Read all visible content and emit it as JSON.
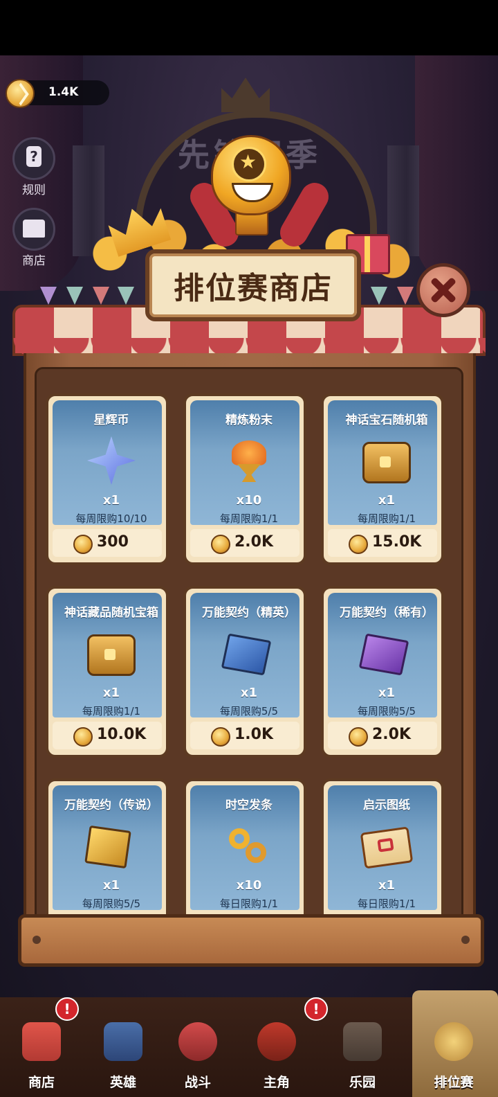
{
  "currency": {
    "amount": "1.4K",
    "icon": "ranked-coin-icon"
  },
  "side_buttons": {
    "rules": "规则",
    "shop": "商店"
  },
  "banner": {
    "season_text": "先锋赛季"
  },
  "shop": {
    "title": "排位赛商店"
  },
  "items": [
    {
      "name": "星辉币",
      "icon": "star-coin-icon",
      "qty": "x1",
      "limit": "每周限购10/10",
      "price": "300"
    },
    {
      "name": "精炼粉末",
      "icon": "refine-powder-icon",
      "qty": "x10",
      "limit": "每周限购1/1",
      "price": "2.0K"
    },
    {
      "name": "神话宝石随机箱",
      "icon": "treasure-chest-icon",
      "qty": "x1",
      "limit": "每周限购1/1",
      "price": "15.0K"
    },
    {
      "name": "神话藏品随机宝箱",
      "icon": "treasure-chest-icon",
      "qty": "x1",
      "limit": "每周限购1/1",
      "price": "10.0K"
    },
    {
      "name": "万能契约（精英）",
      "icon": "blue-book-icon",
      "qty": "x1",
      "limit": "每周限购5/5",
      "price": "1.0K"
    },
    {
      "name": "万能契约（稀有）",
      "icon": "purple-book-icon",
      "qty": "x1",
      "limit": "每周限购5/5",
      "price": "2.0K"
    },
    {
      "name": "万能契约（传说）",
      "icon": "gold-book-icon",
      "qty": "x1",
      "limit": "每周限购5/5",
      "price": ""
    },
    {
      "name": "时空发条",
      "icon": "clockwork-spring-icon",
      "qty": "x10",
      "limit": "每日限购1/1",
      "price": ""
    },
    {
      "name": "启示图纸",
      "icon": "scroll-icon",
      "qty": "x1",
      "limit": "每日限购1/1",
      "price": ""
    }
  ],
  "bottom_nav": [
    {
      "label": "商店",
      "badge": "!"
    },
    {
      "label": "英雄",
      "badge": ""
    },
    {
      "label": "战斗",
      "badge": ""
    },
    {
      "label": "主角",
      "badge": "!"
    },
    {
      "label": "乐园",
      "badge": ""
    },
    {
      "label": "排位赛",
      "badge": ""
    }
  ]
}
